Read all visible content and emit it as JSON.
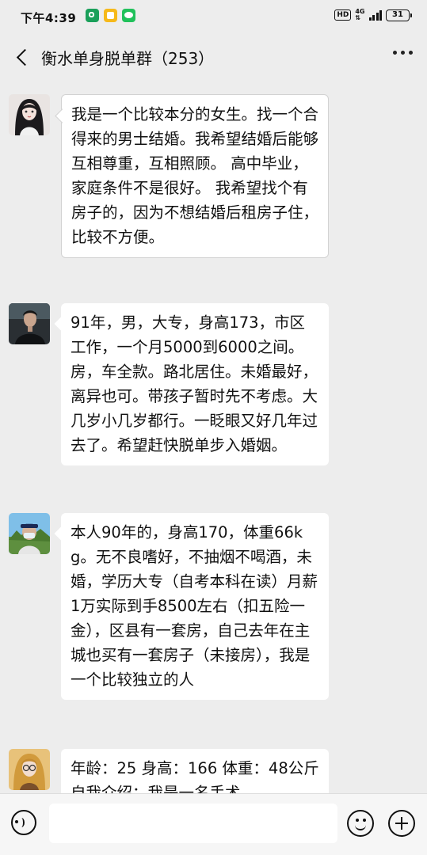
{
  "status_bar": {
    "time": "下午4:39",
    "network": "4G",
    "battery": "31"
  },
  "header": {
    "title": "衡水单身脱单群（253）"
  },
  "messages": [
    {
      "text": "我是一个比较本分的女生。找一个合得来的男士结婚。我希望结婚后能够互相尊重，互相照顾。 高中毕业，家庭条件不是很好。 我希望找个有房子的，因为不想结婚后租房子住，比较不方便。"
    },
    {
      "text": "91年，男，大专，身高173，市区工作，一个月5000到6000之间。房，车全款。路北居住。未婚最好，离异也可。带孩子暂时先不考虑。大几岁小几岁都行。一眨眼又好几年过去了。希望赶快脱单步入婚姻。"
    },
    {
      "text": "本人90年的，身高170，体重66kg。无不良嗜好，不抽烟不喝酒，未婚，学历大专（自考本科在读）月薪1万实际到手8500左右（扣五险一金），区县有一套房，自己去年在主城也买有一套房子（未接房），我是一个比较独立的人"
    },
    {
      "text": "年龄：25 身高：166 体重：48公斤 自我介绍：我是一名手术"
    }
  ],
  "colors": {
    "background": "#ededed",
    "bubble": "#ffffff",
    "input_bar": "#f6f6f6"
  },
  "icons": [
    "back-arrow-icon",
    "more-dots-icon",
    "voice-icon",
    "emoji-icon",
    "plus-icon"
  ]
}
